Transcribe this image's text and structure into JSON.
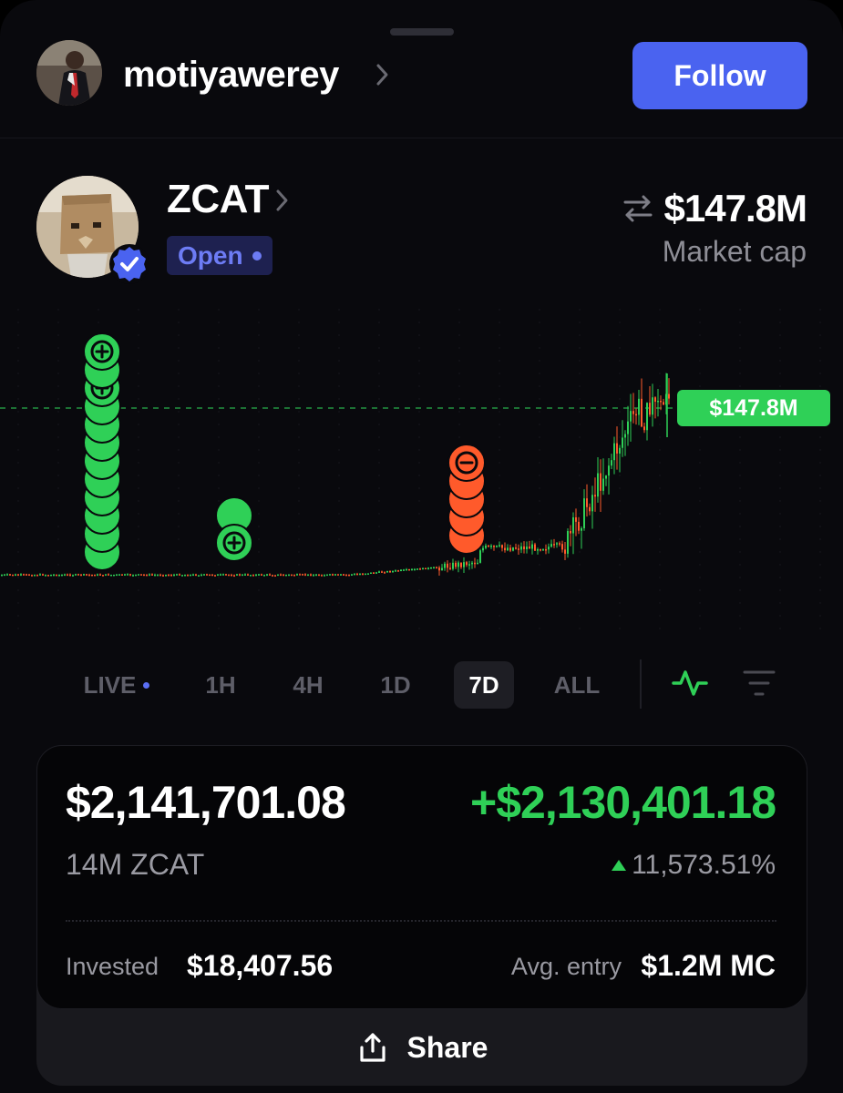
{
  "header": {
    "username": "motiyawerey",
    "follow_label": "Follow"
  },
  "token": {
    "name": "ZCAT",
    "status": "Open",
    "market_cap": "$147.8M",
    "market_cap_label": "Market cap"
  },
  "chart": {
    "current_price_label": "$147.8M",
    "buy_marker_icon": "plus-circle-icon",
    "sell_marker_icon": "minus-circle-icon"
  },
  "time_ranges": [
    "LIVE",
    "1H",
    "4H",
    "1D",
    "7D",
    "ALL"
  ],
  "active_range": "7D",
  "position": {
    "value": "$2,141,701.08",
    "pnl": "+$2,130,401.18",
    "holdings": "14M ZCAT",
    "pnl_pct": "11,573.51%",
    "invested_label": "Invested",
    "invested_value": "$18,407.56",
    "avg_entry_label": "Avg. entry",
    "avg_entry_value": "$1.2M MC",
    "share_label": "Share"
  },
  "colors": {
    "accent": "#4a63f0",
    "up": "#2fd057",
    "down": "#ff5a2b",
    "background": "#09090d"
  }
}
